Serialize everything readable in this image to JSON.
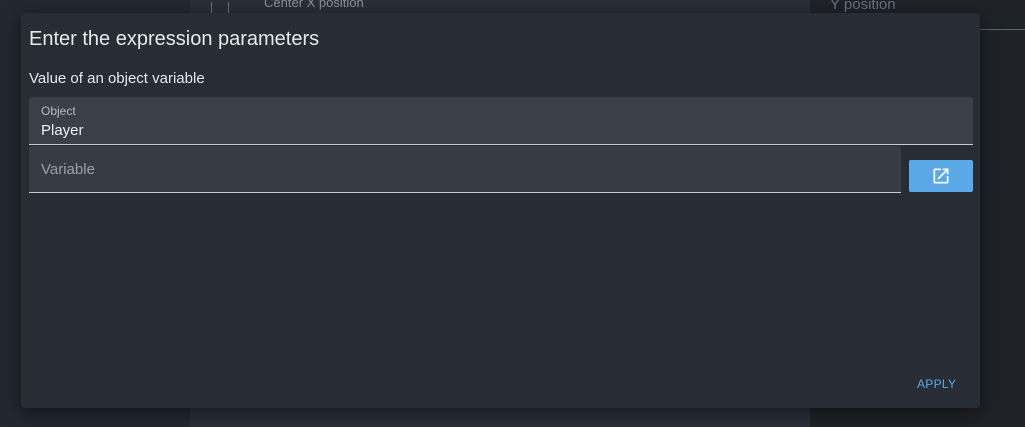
{
  "background": {
    "center_label": "Center X position",
    "right_label": "Y position"
  },
  "dialog": {
    "title": "Enter the expression parameters",
    "subtitle": "Value of an object variable",
    "object_field": {
      "label": "Object",
      "value": "Player"
    },
    "variable_field": {
      "placeholder": "Variable"
    },
    "open_button_icon": "open-in-new-icon",
    "apply_label": "APPLY"
  },
  "colors": {
    "accent": "#5aa9e6",
    "dialog_bg": "#282c34",
    "field_bg": "#3a3f48"
  }
}
